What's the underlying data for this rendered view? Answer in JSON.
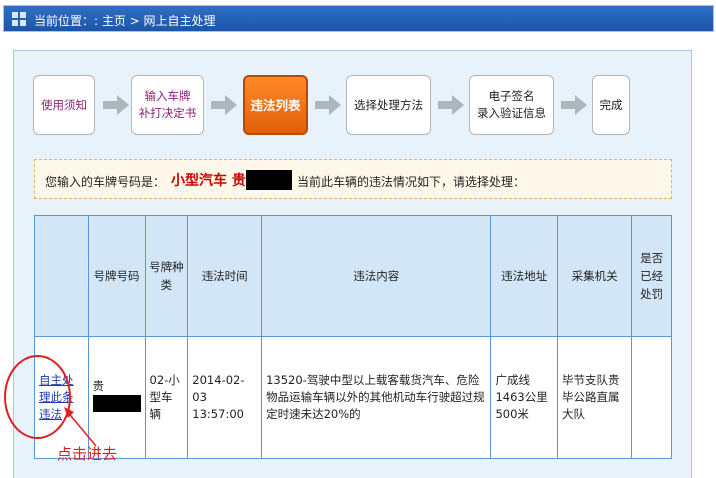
{
  "header": {
    "location_text": "当前位置：: 主页 > 网上自主处理"
  },
  "steps": [
    {
      "label_line1": "使用须知",
      "label_line2": ""
    },
    {
      "label_line1": "输入车牌",
      "label_line2": "补打决定书"
    },
    {
      "label_line1": "违法列表",
      "label_line2": ""
    },
    {
      "label_line1": "选择处理方法",
      "label_line2": ""
    },
    {
      "label_line1": "电子签名",
      "label_line2": "录入验证信息"
    },
    {
      "label_line1": "完成",
      "label_line2": ""
    }
  ],
  "info": {
    "prefix": "您输入的车牌号码是：",
    "plate": "小型汽车 贵",
    "suffix": "当前此车辆的违法情况如下，请选择处理："
  },
  "table": {
    "headers": [
      "",
      "号牌号码",
      "号牌种类",
      "违法时间",
      "违法内容",
      "违法地址",
      "采集机关",
      "是否已经处罚"
    ],
    "row": {
      "action_link": "自主处理此条违法",
      "plate": "贵",
      "plate_type": "02-小型车辆",
      "time": "2014-02-03 13:57:00",
      "content": "13520-驾驶中型以上载客载货汽车、危险物品运输车辆以外的其他机动车行驶超过规定时速未达20%的",
      "address": "广成线1463公里500米",
      "agency": "毕节支队贵毕公路直属大队",
      "punished": ""
    }
  },
  "annotation": {
    "text": "点击进去",
    "color": "#e02020"
  },
  "colors": {
    "active_step": "#f07a1a",
    "link": "#1c3bb5",
    "plate_red": "#cc0000",
    "topbar_blue": "#1c56a8"
  },
  "icons": [
    "grid-icon",
    "step-arrow-icon"
  ]
}
